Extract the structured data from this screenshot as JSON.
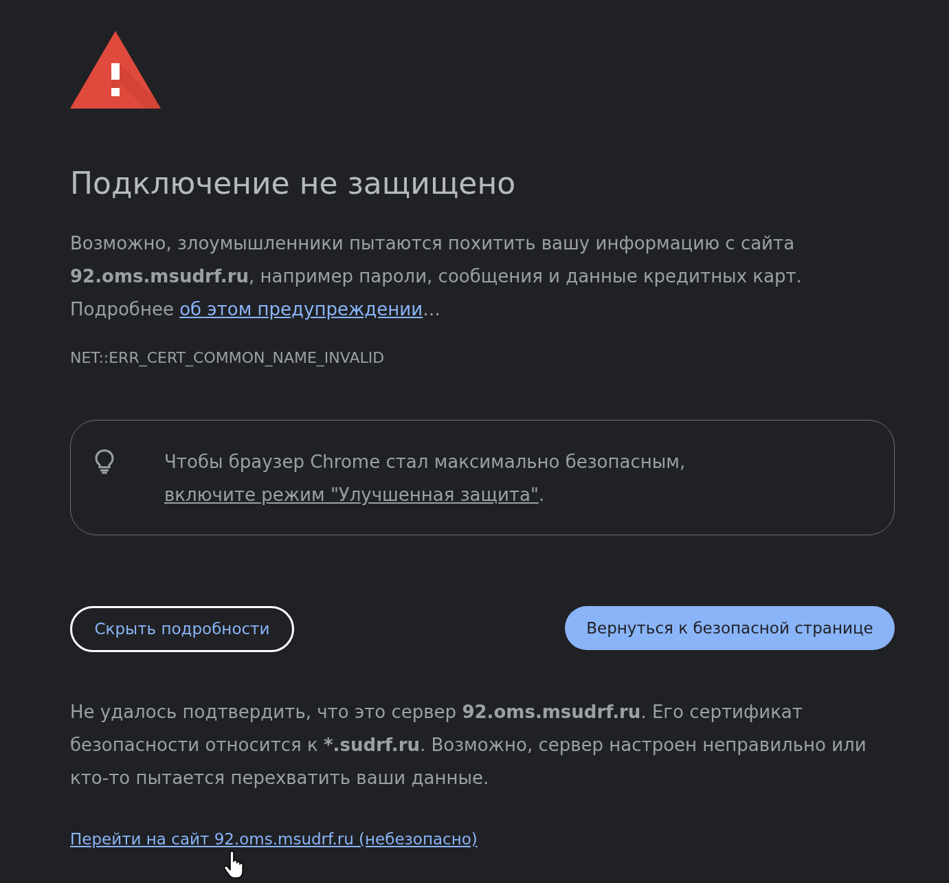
{
  "heading": "Подключение не защищено",
  "message": {
    "text": "Возможно, злоумышленники пытаются похитить вашу информацию с сайта **92.oms.msudrf.ru**, например пароли, сообщения и данные кредитных карт. Подробнее",
    "link": "об этом предупреждении",
    "after": "…"
  },
  "error_code": "NET::ERR_CERT_COMMON_NAME_INVALID",
  "tip": {
    "text": "Чтобы браузер Chrome стал максимально безопасным,",
    "link": "включите режим \"Улучшенная защита\"",
    "after": "."
  },
  "buttons": [
    {
      "label": "Скрыть подробности",
      "kind": "secondary"
    },
    {
      "label": "Вернуться к безопасной странице",
      "kind": "primary"
    }
  ],
  "details": {
    "text": "Не удалось подтвердить, что это сервер **92.oms.msudrf.ru**. Его сертификат безопасности относится к ***.sudrf.ru**. Возможно, сервер настроен неправильно или кто-то пытается перехватить ваши данные."
  },
  "proceed_link": "Перейти на сайт 92.oms.msudrf.ru (небезопасно)"
}
